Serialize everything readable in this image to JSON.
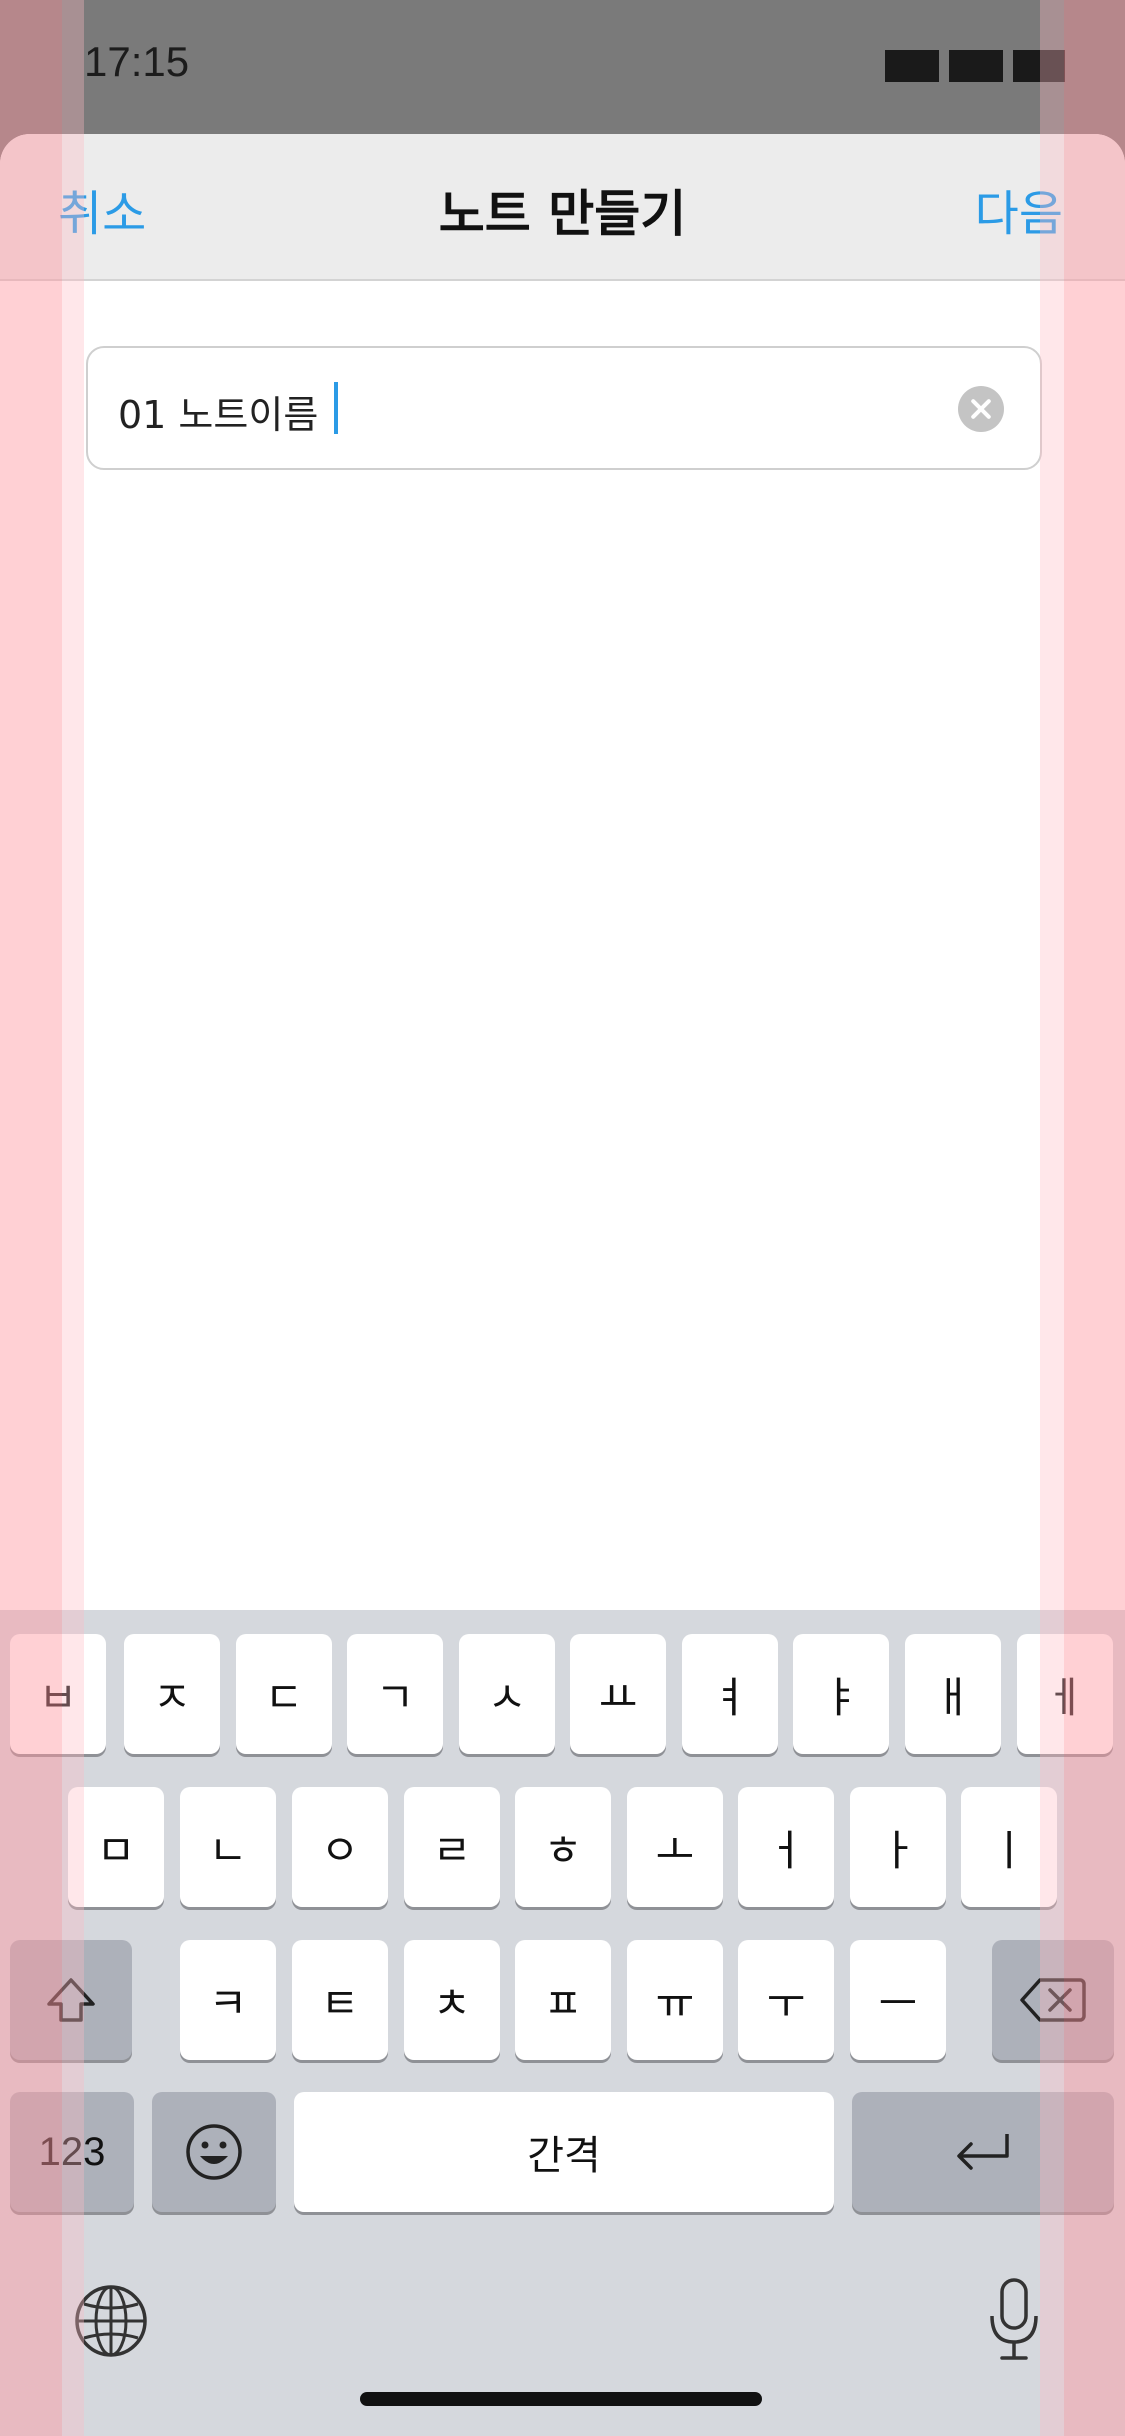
{
  "status": {
    "time": "17:15"
  },
  "nav": {
    "cancel": "취소",
    "title": "노트 만들기",
    "next": "다음"
  },
  "field": {
    "value": "01 노트이름"
  },
  "keyboard": {
    "row1": [
      "ㅂ",
      "ㅈ",
      "ㄷ",
      "ㄱ",
      "ㅅ",
      "ㅛ",
      "ㅕ",
      "ㅑ",
      "ㅐ",
      "ㅔ"
    ],
    "row2": [
      "ㅁ",
      "ㄴ",
      "ㅇ",
      "ㄹ",
      "ㅎ",
      "ㅗ",
      "ㅓ",
      "ㅏ",
      "ㅣ"
    ],
    "row3": [
      "ㅋ",
      "ㅌ",
      "ㅊ",
      "ㅍ",
      "ㅠ",
      "ㅜ",
      "ㅡ"
    ],
    "numbers": "123",
    "space": "간격",
    "icons": [
      "shift-icon",
      "backspace-icon",
      "emoji-icon",
      "return-icon",
      "globe-icon",
      "microphone-icon"
    ]
  },
  "colors": {
    "accent": "#2b9be6",
    "overlay": "#ff96a0"
  }
}
